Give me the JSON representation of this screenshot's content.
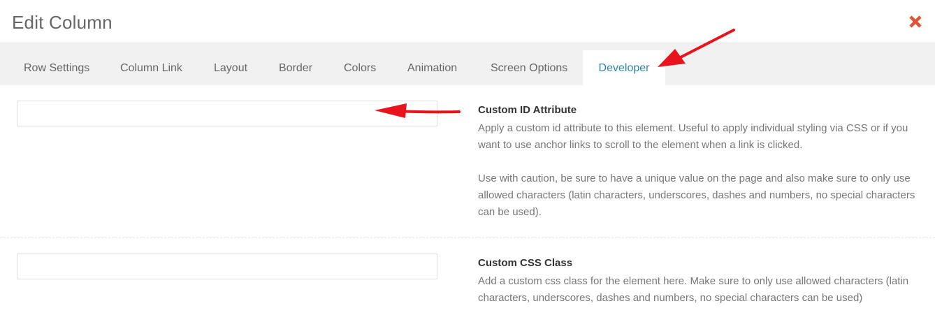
{
  "modal": {
    "title": "Edit Column",
    "close_icon": "close-icon"
  },
  "tabs": [
    {
      "label": "Row Settings",
      "active": false
    },
    {
      "label": "Column Link",
      "active": false
    },
    {
      "label": "Layout",
      "active": false
    },
    {
      "label": "Border",
      "active": false
    },
    {
      "label": "Colors",
      "active": false
    },
    {
      "label": "Animation",
      "active": false
    },
    {
      "label": "Screen Options",
      "active": false
    },
    {
      "label": "Developer",
      "active": true
    }
  ],
  "settings": {
    "custom_id": {
      "value": "",
      "title": "Custom ID Attribute",
      "description": "Apply a custom id attribute to this element. Useful to apply individual styling via CSS or if you want to use anchor links to scroll to the element when a link is clicked.",
      "note": "Use with caution, be sure to have a unique value on the page and also make sure to only use allowed characters (latin characters, underscores, dashes and numbers, no special characters can be used)."
    },
    "custom_css": {
      "value": "",
      "title": "Custom CSS Class",
      "description": "Add a custom css class for the element here. Make sure to only use allowed characters (latin characters, underscores, dashes and numbers, no special characters can be used)"
    }
  },
  "colors": {
    "active_tab_text": "#2a88a8",
    "close_icon": "#e0533a",
    "annotation_arrow": "#e8131b"
  }
}
